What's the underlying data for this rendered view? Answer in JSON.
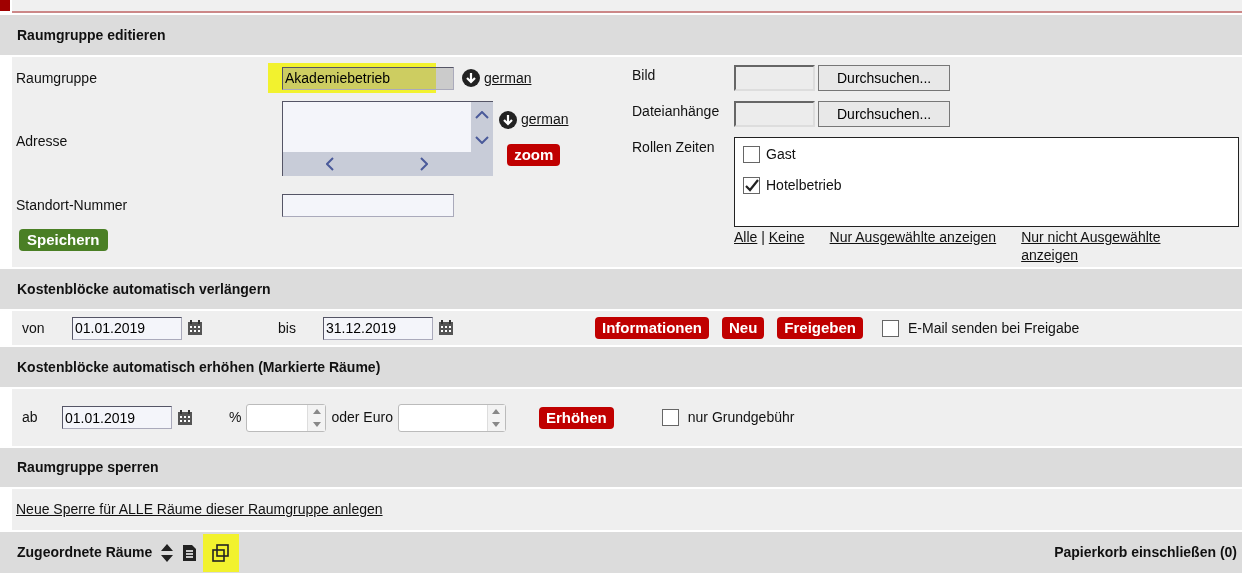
{
  "edit_section": {
    "title": "Raumgruppe editieren",
    "fields": [
      {
        "label": "Raumgruppe",
        "kind": "text",
        "value": "Akademiebetrieb",
        "highlighted": true,
        "language_link": "german"
      },
      {
        "label": "Adresse",
        "kind": "textarea",
        "language_link": "german",
        "zoom_button": "zoom"
      },
      {
        "label": "Standort-Nummer",
        "kind": "text"
      }
    ],
    "save_button": "Speichern",
    "uploads": [
      {
        "label": "Bild",
        "button": "Durchsuchen..."
      },
      {
        "label": "Dateianhänge",
        "button": "Durchsuchen..."
      }
    ],
    "roles": {
      "label": "Rollen Zeiten",
      "items": [
        {
          "label": "Gast",
          "checked": false
        },
        {
          "label": "Hotelbetrieb",
          "checked": true
        }
      ],
      "links": [
        "Alle",
        "Keine",
        "Nur Ausgewählte anzeigen",
        "Nur nicht Ausgewählte anzeigen"
      ],
      "separator": "|"
    }
  },
  "extend_section": {
    "title": "Kostenblöcke automatisch verlängern",
    "from_label": "von",
    "from": "01.01.2019",
    "to_label": "bis",
    "to": "31.12.2019",
    "buttons": [
      "Informationen",
      "Neu",
      "Freigeben"
    ],
    "email": {
      "label": "E-Mail senden bei Freigabe",
      "checked": false
    }
  },
  "increase_section": {
    "title": "Kostenblöcke automatisch erhöhen (Markierte Räume)",
    "from_label": "ab",
    "from": "01.01.2019",
    "percent_label": "%",
    "euro_label": "oder Euro",
    "button": "Erhöhen",
    "base_fee": {
      "label": "nur Grundgebühr",
      "checked": false
    }
  },
  "lock_section": {
    "title": "Raumgruppe sperren",
    "link": "Neue Sperre für ALLE Räume dieser Raumgruppe anlegen"
  },
  "rooms_section": {
    "title": "Zugeordnete Räume",
    "icons": [
      {
        "kind": "sort",
        "highlighted": false
      },
      {
        "kind": "document",
        "highlighted": false
      },
      {
        "kind": "copy",
        "highlighted": true
      }
    ],
    "trash": "Papierkorb einschließen (0)"
  }
}
